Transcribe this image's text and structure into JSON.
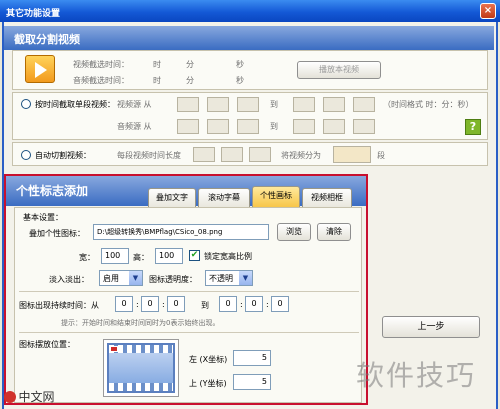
{
  "window": {
    "title": "其它功能设置"
  },
  "split_section": {
    "header": "截取分割视频",
    "video_start_label": "视频截选时间：",
    "video_end_label": "音频截选时间：",
    "unit_hour": "时",
    "unit_minute": "分",
    "unit_second": "秒",
    "preview_button": "播放本视频",
    "by_time_label": "按时间截取单段视频：",
    "video_label": "视频源 从",
    "audio_label": "音频源 从",
    "to_label": "到",
    "time_format_hint": "（时间格式 时：分：秒）",
    "auto_split_label": "自动切割视频：",
    "per_segment_label": "每段视频时间长度",
    "split_into_label": "将视频分为",
    "segment_unit": "段"
  },
  "logo_section": {
    "header": "个性标志添加",
    "tabs": [
      "叠加文字",
      "滚动字幕",
      "个性画标",
      "视频相框"
    ],
    "basic_settings": "基本设置：",
    "logo_label": "叠加个性图标：",
    "logo_path": "D:\\超级转换秀\\BMPflag\\CSico_08.png",
    "browse_button": "浏览",
    "clear_button": "清除",
    "width_label": "宽：",
    "width_value": "100",
    "height_label": "高：",
    "height_value": "100",
    "lock_ratio_label": "锁定宽高比例",
    "fade_label": "淡入淡出：",
    "fade_value": "启用",
    "opacity_label": "图标透明度：",
    "opacity_value": "不透明",
    "show_time_label": "图标出现持续时间：从",
    "to_label": "到",
    "time_values": [
      "0",
      "0",
      "0"
    ],
    "end_values": [
      "0",
      "0",
      "0"
    ],
    "hint": "提示：开始时间和结束时间同时为0表示始终出现。",
    "position_label": "图标摆放位置：",
    "left_label": "左 (X坐标)",
    "left_value": "5",
    "top_label": "上 (Y坐标)",
    "top_value": "5"
  },
  "prev_button": "上一步",
  "watermark": {
    "text1": "软件技巧",
    "text2": "中文网"
  }
}
